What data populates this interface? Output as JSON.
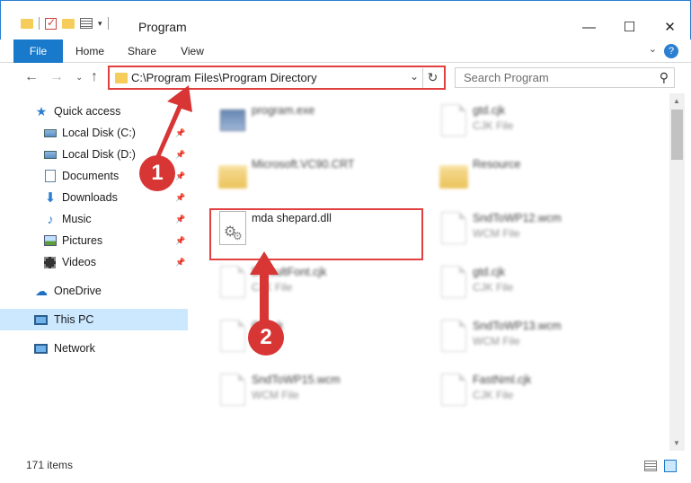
{
  "window": {
    "title": "Program",
    "minimize": "—",
    "maximize": "☐",
    "close": "✕"
  },
  "ribbon": {
    "tabs": [
      "File",
      "Home",
      "Share",
      "View"
    ],
    "help": "?"
  },
  "address": {
    "path": "C:\\Program Files\\Program Directory",
    "search_placeholder": "Search Program"
  },
  "sidebar": {
    "items": [
      {
        "label": "Quick access",
        "icon": "star-icon"
      },
      {
        "label": "Local Disk (C:)",
        "icon": "drive-icon"
      },
      {
        "label": "Local Disk (D:)",
        "icon": "drive-icon"
      },
      {
        "label": "Documents",
        "icon": "documents-icon"
      },
      {
        "label": "Downloads",
        "icon": "downloads-icon"
      },
      {
        "label": "Music",
        "icon": "music-icon"
      },
      {
        "label": "Pictures",
        "icon": "pictures-icon"
      },
      {
        "label": "Videos",
        "icon": "videos-icon"
      },
      {
        "label": "OneDrive",
        "icon": "cloud-icon"
      },
      {
        "label": "This PC",
        "icon": "computer-icon"
      },
      {
        "label": "Network",
        "icon": "network-icon"
      }
    ]
  },
  "files": [
    {
      "name": "program.exe",
      "type": "",
      "icon": "exe"
    },
    {
      "name": "gtd.cjk",
      "type": "CJK File",
      "icon": "page"
    },
    {
      "name": "Microsoft.VC90.CRT",
      "type": "",
      "icon": "folder"
    },
    {
      "name": "Resource",
      "type": "",
      "icon": "folder"
    },
    {
      "name": "mda shepard.dll",
      "type": "",
      "icon": "dll"
    },
    {
      "name": "SndToWP12.wcm",
      "type": "WCM File",
      "icon": "page"
    },
    {
      "name": "DefaultFont.cjk",
      "type": "CJK File",
      "icon": "page"
    },
    {
      "name": "gtd.cjk",
      "type": "CJK File",
      "icon": "page"
    },
    {
      "name": "Check",
      "type": "File",
      "icon": "page"
    },
    {
      "name": "SndToWP13.wcm",
      "type": "WCM File",
      "icon": "page"
    },
    {
      "name": "SndToWP15.wcm",
      "type": "WCM File",
      "icon": "page"
    },
    {
      "name": "FastNml.cjk",
      "type": "CJK File",
      "icon": "page"
    }
  ],
  "status": {
    "count": "171 items"
  },
  "annotations": {
    "step1": "1",
    "step2": "2",
    "color": "#d83535"
  }
}
